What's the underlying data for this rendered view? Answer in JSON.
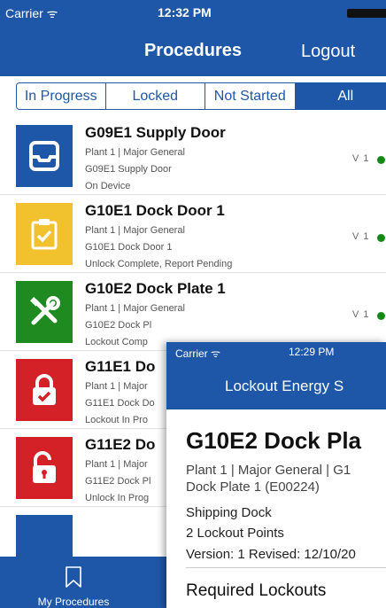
{
  "status_bar": {
    "carrier": "Carrier ᯤ",
    "time": "12:32 PM"
  },
  "nav": {
    "title": "Procedures",
    "logout_label": "Logout"
  },
  "filters": {
    "selected": "All",
    "items": [
      {
        "label": "In Progress"
      },
      {
        "label": "Locked"
      },
      {
        "label": "Not Started"
      },
      {
        "label": "All"
      }
    ]
  },
  "procedures": [
    {
      "title": "G09E1 Supply Door",
      "plant": "Plant 1 | Major General",
      "desc": "G09E1 Supply Door",
      "status": "On Device",
      "version": "V 1",
      "icon": "device-icon",
      "color": "#1f57a8"
    },
    {
      "title": "G10E1 Dock Door 1",
      "plant": "Plant 1 | Major General",
      "desc": "G10E1 Dock Door 1",
      "status": "Unlock Complete, Report Pending",
      "version": "V 1",
      "icon": "clipboard-check-icon",
      "color": "#f2c12e"
    },
    {
      "title": "G10E2 Dock Plate 1",
      "plant": "Plant 1 | Major General",
      "desc": "G10E2 Dock Pl",
      "status": "Lockout Comp",
      "version": "V 1",
      "icon": "tools-icon",
      "color": "#1f8a1f"
    },
    {
      "title": "G11E1 Do",
      "plant": "Plant 1 | Major",
      "desc": "G11E1 Dock Do",
      "status": "Lockout In Pro",
      "version": "",
      "icon": "lock-check-icon",
      "color": "#d42027"
    },
    {
      "title": "G11E2 Do",
      "plant": "Plant 1 | Major",
      "desc": "G11E2 Dock Pl",
      "status": "Unlock In Prog",
      "version": "",
      "icon": "unlock-icon",
      "color": "#d42027"
    }
  ],
  "tab_bar": {
    "my_procedures_label": "My Procedures"
  },
  "detail_overlay": {
    "status_carrier": "Carrier ᯤ",
    "status_time": "12:29 PM",
    "nav_title": "Lockout Energy S",
    "title": "G10E2 Dock Pla",
    "plant_line1": "Plant 1 | Major General | G1",
    "plant_line2": "Dock Plate 1 (E00224)",
    "location": "Shipping Dock",
    "lockout_points": "2 Lockout Points",
    "version": "Version: 1 Revised: 12/10/20",
    "section_heading": "Required Lockouts"
  },
  "colors": {
    "brand_blue": "#1f57a8",
    "status_green": "#148a14",
    "warning_yellow": "#f2c12e",
    "danger_red": "#d42027",
    "success_green": "#1f8a1f"
  }
}
